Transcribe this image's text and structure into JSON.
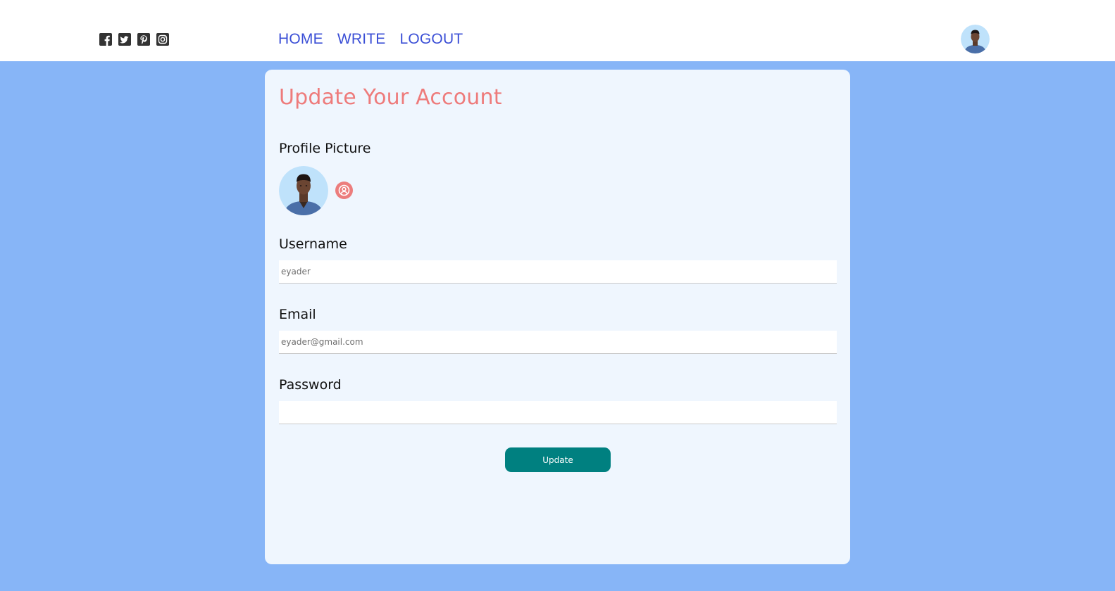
{
  "social": {
    "icons": [
      "facebook-square-icon",
      "twitter-square-icon",
      "pinterest-square-icon",
      "instagram-icon"
    ],
    "icon_color": "#333333"
  },
  "nav": {
    "items": [
      {
        "label": "HOME"
      },
      {
        "label": "WRITE"
      },
      {
        "label": "LOGOUT"
      }
    ],
    "color": "#3b4fd6"
  },
  "header": {
    "avatar_icon": "user-avatar"
  },
  "form": {
    "title": "Update Your Account",
    "profile_picture_label": "Profile Picture",
    "upload_icon": "user-circle-icon",
    "username_label": "Username",
    "username_placeholder": "eyader",
    "email_label": "Email",
    "email_placeholder": "eyader@gmail.com",
    "password_label": "Password",
    "password_placeholder": "",
    "update_label": "Update"
  },
  "colors": {
    "page_background": "#87b5f7",
    "card_background": "#eff6fe",
    "title_color": "#ee7b7b",
    "button_color": "#008080"
  }
}
